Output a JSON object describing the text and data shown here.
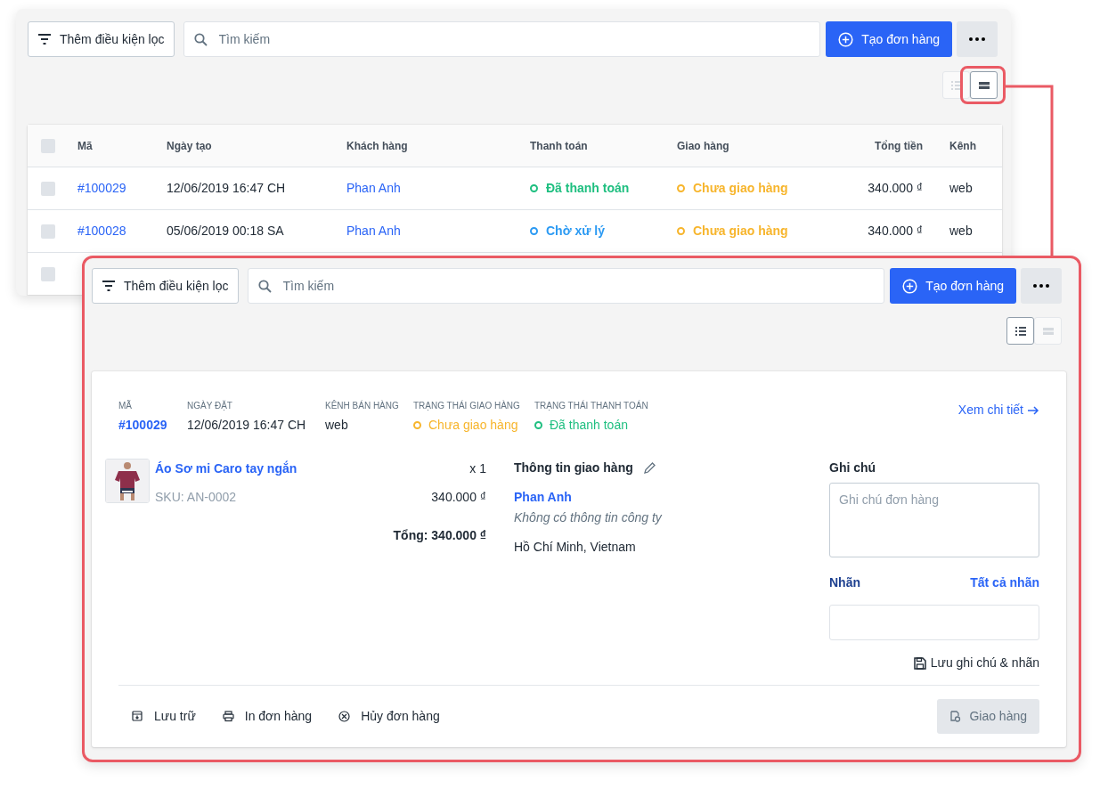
{
  "list_view": {
    "toolbar": {
      "filter_button": "Thêm điều kiện lọc",
      "search_placeholder": "Tìm kiếm",
      "create_button": "Tạo đơn hàng"
    },
    "view_toggle": [
      {
        "kind": "list",
        "selected": false
      },
      {
        "kind": "card",
        "selected": true
      }
    ],
    "table": {
      "select_all_checked": false,
      "columns": [
        "Mã",
        "Ngày tạo",
        "Khách hàng",
        "Thanh toán",
        "Giao hàng",
        "Tổng tiền",
        "Kênh"
      ],
      "rows": [
        {
          "checked": false,
          "code": "#100029",
          "date": "12/06/2019 16:47 CH",
          "customer": "Phan Anh",
          "payment": {
            "text": "Đã thanh toán",
            "color": "#1fbf80"
          },
          "shipping": {
            "text": "Chưa giao hàng",
            "color": "#f7b52c"
          },
          "total": "340.000 ₫",
          "channel": "web"
        },
        {
          "checked": false,
          "code": "#100028",
          "date": "05/06/2019 00:18 SA",
          "customer": "Phan Anh",
          "payment": {
            "text": "Chờ xử lý",
            "color": "#2b9af3"
          },
          "shipping": {
            "text": "Chưa giao hàng",
            "color": "#f7b52c"
          },
          "total": "340.000 ₫",
          "channel": "web"
        },
        {
          "checked": false
        }
      ]
    }
  },
  "card_view": {
    "toolbar": {
      "filter_button": "Thêm điều kiện lọc",
      "search_placeholder": "Tìm kiếm",
      "create_button": "Tạo đơn hàng"
    },
    "view_toggle": [
      {
        "kind": "list",
        "selected": true
      },
      {
        "kind": "card",
        "selected": false
      }
    ],
    "order": {
      "meta": [
        {
          "kind": "code",
          "label": "MÃ",
          "value": "#100029"
        },
        {
          "kind": "text",
          "label": "NGÀY ĐẶT",
          "value": "12/06/2019 16:47 CH"
        },
        {
          "kind": "text",
          "label": "KÊNH BÁN HÀNG",
          "value": "web"
        },
        {
          "kind": "status",
          "label": "TRẠNG THÁI GIAO HÀNG",
          "value": "Chưa giao hàng",
          "color": "#f7b52c"
        },
        {
          "kind": "status",
          "label": "TRẠNG THÁI THANH TOÁN",
          "value": "Đã thanh toán",
          "color": "#1fbf80"
        }
      ],
      "detail_link": "Xem chi tiết",
      "items": [
        {
          "name": "Áo Sơ mi Caro tay ngắn",
          "sku": "SKU: AN-0002",
          "quantity": "x 1",
          "price": "340.000 ₫"
        }
      ],
      "total": "Tổng: 340.000 ₫",
      "shipping": {
        "title": "Thông tin giao hàng",
        "customer": "Phan Anh",
        "company": "Không có thông tin công ty",
        "address": "Hồ Chí Minh, Vietnam"
      },
      "note": {
        "label": "Ghi chú",
        "placeholder": "Ghi chú đơn hàng"
      },
      "tags": {
        "label": "Nhãn",
        "link": "Tất cả nhãn"
      },
      "save_link": "Lưu ghi chú & nhãn",
      "actions": [
        {
          "kind": "archive",
          "label": "Lưu trữ"
        },
        {
          "kind": "print",
          "label": "In đơn hàng"
        },
        {
          "kind": "cancel",
          "label": "Hủy đơn hàng"
        }
      ],
      "ship_button": "Giao hàng"
    }
  }
}
